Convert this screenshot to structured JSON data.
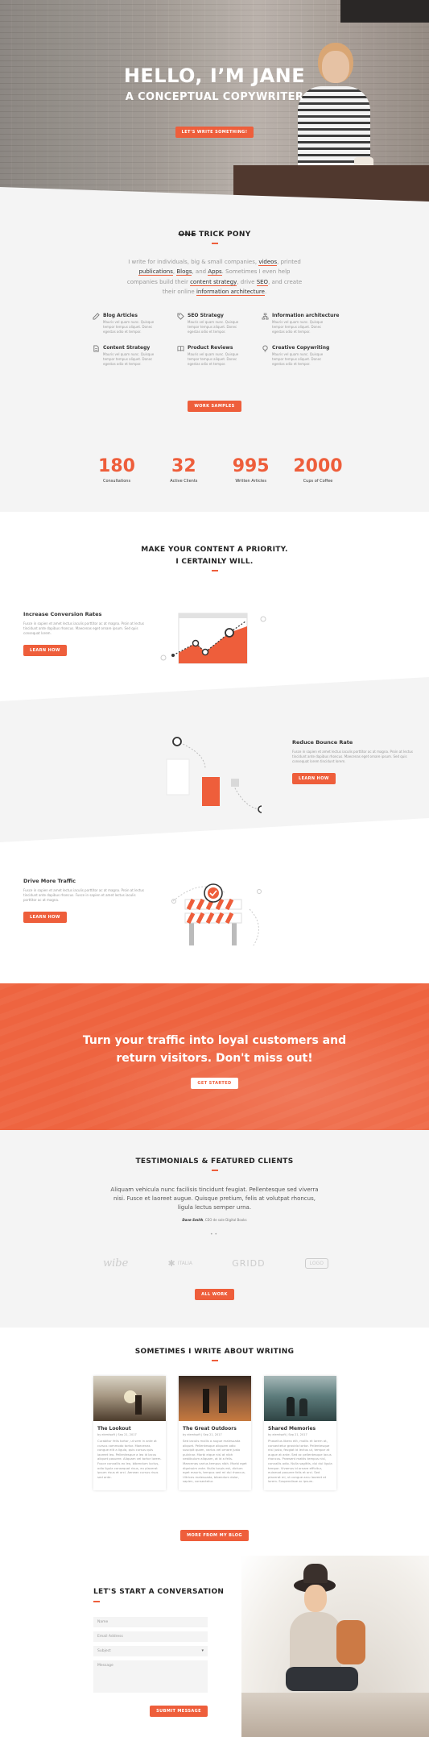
{
  "hero": {
    "title": "HELLO, I’M JANE",
    "subtitle": "A CONCEPTUAL COPYWRITER",
    "cta": "LET'S WRITE SOMETHING!"
  },
  "about": {
    "title_strike": "ONE",
    "title_rest": "TRICK PONY",
    "intro_parts": [
      "I write for individuals, big & small companies, ",
      "videos",
      ", printed ",
      "publications",
      ", ",
      "Blogs",
      ", and ",
      "Apps",
      ". Sometimes I even help companies build their ",
      "content strategy",
      ", drive ",
      "SEO",
      ", and create their online ",
      "information architecture",
      "."
    ],
    "services": [
      {
        "icon": "edit-icon",
        "title": "Blog Articles",
        "text": "Mauris vel quam nunc. Quisque tempor tempus aliquet. Donec egestas odio et tempor."
      },
      {
        "icon": "tag-icon",
        "title": "SEO Strategy",
        "text": "Mauris vel quam nunc. Quisque tempor tempus aliquet. Donec egestas odio et tempor."
      },
      {
        "icon": "sitemap-icon",
        "title": "Information architecture",
        "text": "Mauris vel quam nunc. Quisque tempor tempus aliquet. Donec egestas odio et tempor."
      },
      {
        "icon": "document-icon",
        "title": "Content Strategy",
        "text": "Mauris vel quam nunc. Quisque tempor tempus aliquet. Donec egestas odio et tempor."
      },
      {
        "icon": "book-icon",
        "title": "Product Reviews",
        "text": "Mauris vel quam nunc. Quisque tempor tempus aliquet. Donec egestas odio et tempor."
      },
      {
        "icon": "bulb-icon",
        "title": "Creative Copywriting",
        "text": "Mauris vel quam nunc. Quisque tempor tempus aliquet. Donec egestas odio et tempor."
      }
    ],
    "cta": "WORK SAMPLES"
  },
  "stats": [
    {
      "number": "180",
      "label": "Consultations"
    },
    {
      "number": "32",
      "label": "Active Clients"
    },
    {
      "number": "995",
      "label": "Written Articles"
    },
    {
      "number": "2000",
      "label": "Cups of Coffee"
    }
  ],
  "priority": {
    "title_line1": "MAKE YOUR CONTENT A PRIORITY.",
    "title_line2": "I CERTAINLY WILL."
  },
  "features": [
    {
      "title": "Increase Conversion Rates",
      "text": "Fusce in sapien et amet lectus iaculis porttitor ac at magna. Proin at lectus tincidunt ante dapibus rhoncus. Maecenas eget ornare ipsum. Sed quis consequat lorem.",
      "cta": "LEARN HOW"
    },
    {
      "title": "Reduce Bounce Rate",
      "text": "Fusce in sapien et amet lectus iaculis porttitor ac at magna. Proin at lectus tincidunt ante dapibus rhoncus. Maecenas eget ornare ipsum. Sed quis consequat lorem tincidunt lorem.",
      "cta": "LEARN HOW"
    },
    {
      "title": "Drive More Traffic",
      "text": "Fusce in sapien et amet lectus iaculis porttitor ac at magna. Proin at lectus tincidunt ante dapibus rhoncus. Fusce in sapien et amet lectus iaculis porttitor ac at magna.",
      "cta": "LEARN HOW"
    }
  ],
  "banner": {
    "line1": "Turn your traffic into loyal customers and",
    "line2": "return visitors. Don't miss out!",
    "cta": "GET STARTED"
  },
  "testimonials": {
    "title": "TESTIMONIALS & FEATURED CLIENTS",
    "quote": "Aliquam vehicula nunc facilisis tincidunt feugiat. Pellentesque sed viverra nisi. Fusce et laoreet augue. Quisque pretium, felis at volutpat rhoncus, ligula lectus semper urna.",
    "author": "Dave Smith",
    "author_role": ", CEO de sale Digital Books",
    "logos": [
      "wibe",
      "ITALIA",
      "GRIDD",
      "LOGO"
    ],
    "cta": "ALL WORK"
  },
  "blog": {
    "title": "SOMETIMES I WRITE ABOUT WRITING",
    "posts": [
      {
        "title": "The Lookout",
        "meta": "by elemtsoft | Sep 21, 2017",
        "excerpt": "Curabitur felis tortor, ut sem in ante at cursus commodo tortor. Maecenas congue elit a ligula, quis cursus quis laoreet leo. Pellentesque a leo id lacus aliquet posuere. Aliquam vel tortor lorem. Fusce convallis ex leo, bibendum luctus, odio ligula consequat risus, eu placerat ipsum risus et orci. Aenean cursus risus sed ante."
      },
      {
        "title": "The Great Outdoors",
        "meta": "by elemtsoft | Sep 21, 2017",
        "excerpt": "Sed iaculis mollis a augue malesuada aliquet. Pellentesque aliquam odio suscipit quam, varius vel ornare justo pulvinar. Morbi eique nisl at nibh vestibulum aliquam, at id a felis. Maecenas varius tempus nibh. Morbi eget dignissim ante. Nulla turpis est, dictum eget mauris, tempus sed mi dui rhoncus. Ultrices malesuada, bibendum dolor, sapien, consectetur."
      },
      {
        "title": "Shared Memories",
        "meta": "by elemtsoft | Sep 21, 2017",
        "excerpt": "Phasellus libero elit, mollis et lorem at, consectetur gravida tortor. Pellentesque nisl justo, feugiat id lectus ut, tempor at augue at ante. Sed ac pellentesque lacus rhoncus. Praesent mattis tempus nisl, convallis odio. Nulla sagittis, dui dui ligula tempor. Vivamus id ornare efficitur, euismod posuere felis et orci. Sed placerat mi, ut congue arcu laoreet at lorem. Suspendisse ac ipsum."
      }
    ],
    "cta": "MORE FROM MY BLOG"
  },
  "contact": {
    "title": "LET'S START A CONVERSATION",
    "name_placeholder": "Name",
    "email_placeholder": "Email Address",
    "subject_placeholder": "Subject",
    "message_placeholder": "Message",
    "submit": "SUBMIT MESSAGE"
  },
  "colors": {
    "accent": "#ee5e3b",
    "bg_grey": "#f4f4f4"
  }
}
